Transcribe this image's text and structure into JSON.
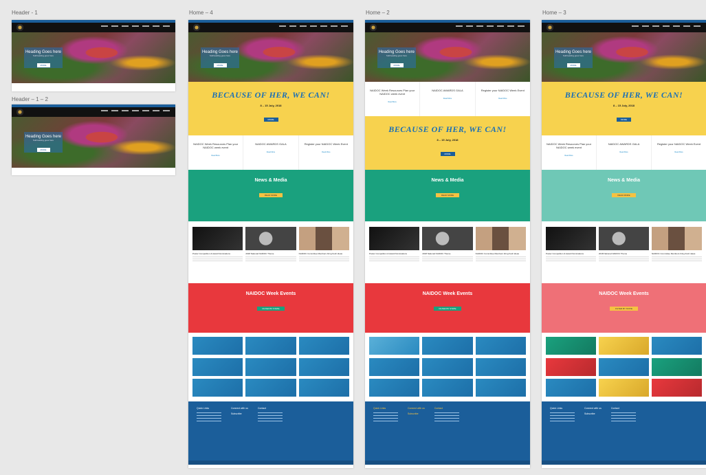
{
  "artboards": {
    "header_1": "Header - 1",
    "header_1_2": "Header – 1 – 2",
    "home_4": "Home – 4",
    "home_2": "Home – 2",
    "home_3": "Home – 3"
  },
  "hero": {
    "title": "Heading Goes here",
    "subtitle": "Subheading goes here",
    "button": "MORE"
  },
  "banner": {
    "headline": "BECAUSE OF HER, WE CAN!",
    "date": "8 – 15 July, 2018",
    "button": "MORE"
  },
  "cards": [
    {
      "title": "NAIDOC Week Resources Plan your NAIDOC week event",
      "link": "Read More"
    },
    {
      "title": "NAIDOC AWARDS GALA",
      "link": "Read More"
    },
    {
      "title": "Register your NAIDOC Week Event",
      "link": "Read More"
    }
  ],
  "news": {
    "title": "News & Media",
    "button": "READ MORE",
    "items": [
      "Poster Competition & Award Nominations",
      "2018 National NAIDOC Theme",
      "NAIDOC Committee Members bring fresh ideas"
    ]
  },
  "events": {
    "title": "NAIDOC Week Events",
    "filter": "FILTER BY STATE"
  },
  "footer": {
    "quick_links": "Quick Links",
    "connect": "Connect with us",
    "contact": "Contact",
    "subscribe": "Subscribe"
  }
}
